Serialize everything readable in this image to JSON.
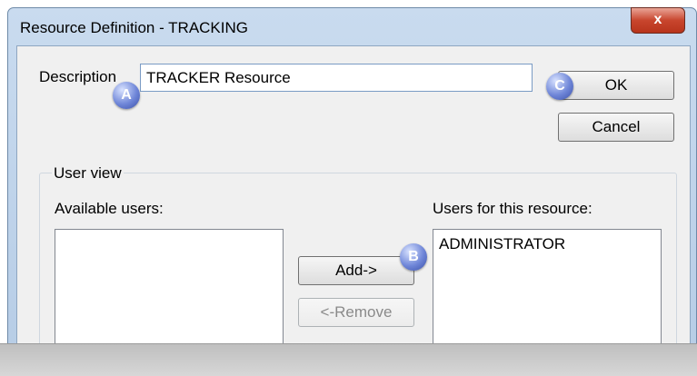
{
  "window": {
    "title": "Resource Definition - TRACKING",
    "close_label": "x"
  },
  "description": {
    "label": "Description",
    "value": "TRACKER Resource"
  },
  "buttons": {
    "ok": "OK",
    "cancel": "Cancel",
    "add": "Add->",
    "remove": "<-Remove"
  },
  "user_view": {
    "caption": "User view",
    "available_label": "Available users:",
    "available_users": [],
    "resource_label": "Users for this resource:",
    "resource_users": [
      "ADMINISTRATOR"
    ]
  },
  "markers": {
    "a": "A",
    "b": "B",
    "c": "C"
  }
}
